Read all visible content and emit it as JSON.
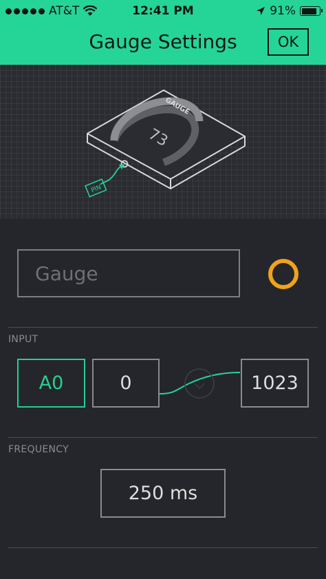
{
  "status_bar": {
    "carrier": "AT&T",
    "time": "12:41 PM",
    "battery_percent": "91%",
    "battery_level": 0.91
  },
  "nav": {
    "title": "Gauge Settings",
    "ok_label": "OK"
  },
  "preview": {
    "widget_label": "GAUGE",
    "gauge_value": "73",
    "pin_label": "PIN"
  },
  "name_field": {
    "placeholder": "Gauge",
    "value": ""
  },
  "color": {
    "accent": "#24d597",
    "widget_color": "#f0a21c"
  },
  "input_section": {
    "label": "INPUT",
    "pin": "A0",
    "min": "0",
    "max": "1023"
  },
  "frequency_section": {
    "label": "FREQUENCY",
    "value": "250 ms"
  }
}
